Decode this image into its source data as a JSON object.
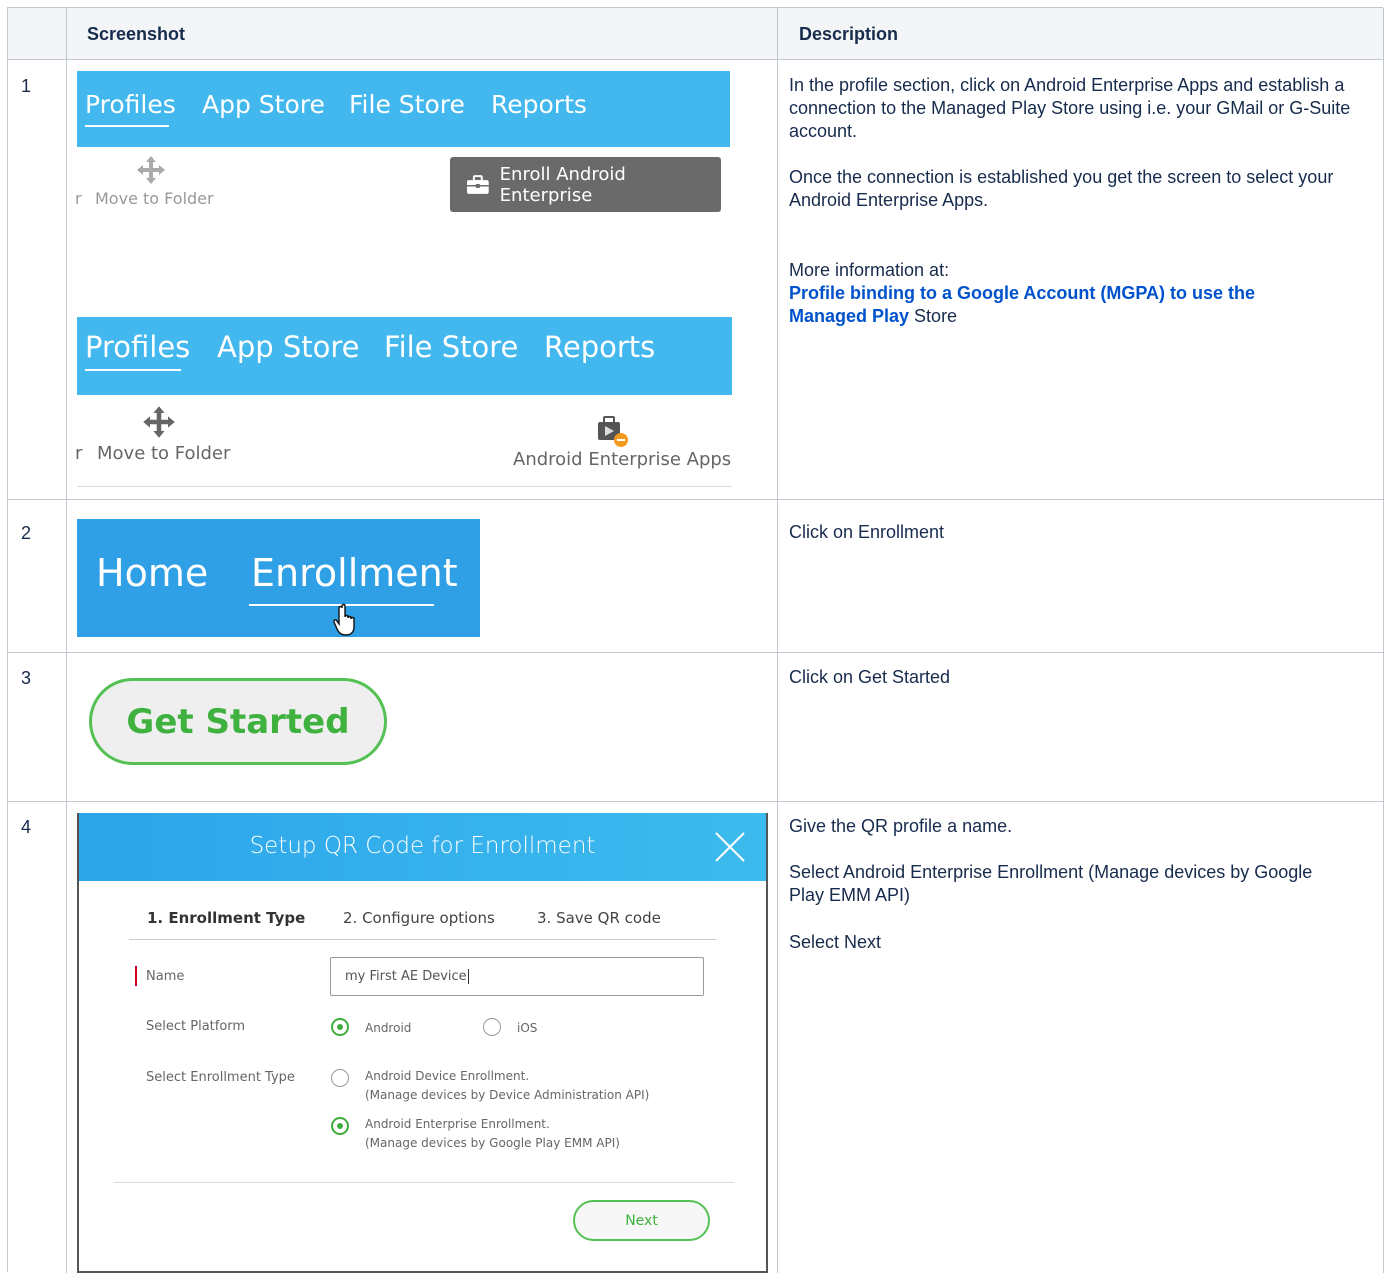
{
  "table": {
    "headers": [
      "Screenshot",
      "Description"
    ],
    "rows": [
      {
        "num": "1"
      },
      {
        "num": "2"
      },
      {
        "num": "3"
      },
      {
        "num": "4"
      }
    ]
  },
  "row1": {
    "nav": [
      "Profiles",
      "App Store",
      "File Store",
      "Reports"
    ],
    "move_to_folder": "Move to Folder",
    "cut_prefix": "r",
    "enroll_button": "Enroll Android Enterprise",
    "ae_apps": "Android Enterprise Apps",
    "desc_p1": "In the profile section, click on Android Enterprise Apps and establish a connection to the Managed Play Store using i.e. your GMail or G-Suite account.",
    "desc_p2": "Once the connection is established you get the screen to select your Android Enterprise Apps.",
    "desc_more": "More information at:",
    "desc_link": "Profile binding to a Google Account (MGPA) to use the Managed Play",
    "desc_link_tail": " Store"
  },
  "row2": {
    "nav": [
      "Home",
      "Enrollment"
    ],
    "desc": "Click on Enrollment"
  },
  "row3": {
    "button": "Get Started",
    "desc": "Click on Get Started"
  },
  "row4": {
    "dialog_title": "Setup QR Code for Enrollment",
    "steps": [
      "1. Enrollment Type",
      "2. Configure options",
      "3. Save QR code"
    ],
    "name_label": "Name",
    "name_value": "my First AE Device",
    "platform_label": "Select Platform",
    "platform_android": "Android",
    "platform_ios": "iOS",
    "enroll_type_label": "Select Enrollment Type",
    "opt1_line1": "Android Device Enrollment.",
    "opt1_line2": "(Manage devices by Device Administration API)",
    "opt2_line1": "Android Enterprise Enrollment.",
    "opt2_line2": "(Manage devices by Google Play EMM API)",
    "next": "Next",
    "desc1": "Give the QR profile a name.",
    "desc2": "Select Android Enterprise Enrollment (Manage devices by Google Play EMM API)",
    "desc3": "Select Next"
  },
  "colors": {
    "banner": "#43b8ee",
    "banner2": "#2f9fe6",
    "accent_green": "#3fb13f",
    "link": "#0052cc"
  }
}
